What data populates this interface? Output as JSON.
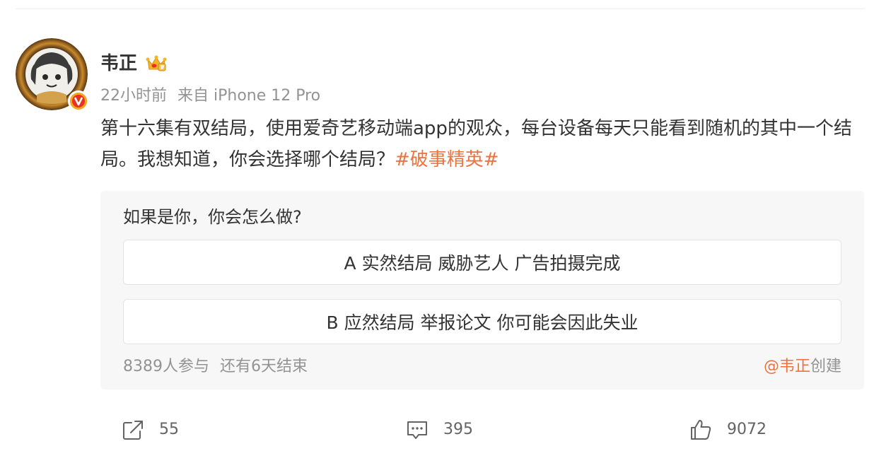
{
  "post": {
    "author": {
      "name": "韦正",
      "crown_icon": "crown-badge-icon",
      "verified_icon": "verified-v-icon"
    },
    "meta": {
      "time": "22小时前",
      "source": "来自 iPhone 12 Pro"
    },
    "text": {
      "body": "第十六集有双结局，使用爱奇艺移动端app的观众，每台设备每天只能看到随机的其中一个结局。我想知道，你会选择哪个结局？",
      "topic": "#破事精英#"
    },
    "poll": {
      "question": "如果是你，你会怎么做?",
      "options": [
        {
          "label": "A 实然结局 威胁艺人 广告拍摄完成"
        },
        {
          "label": "B 应然结局 举报论文 你可能会因此失业"
        }
      ],
      "participants": "8389人参与",
      "remaining": "还有6天结束",
      "creator": "@韦正",
      "creator_suffix": "创建"
    },
    "actions": {
      "repost": {
        "icon": "repost-icon",
        "count": "55"
      },
      "comment": {
        "icon": "comment-icon",
        "count": "395"
      },
      "like": {
        "icon": "like-icon",
        "count": "9072"
      }
    },
    "colors": {
      "accent": "#eb7340",
      "muted_text": "#939393",
      "card_bg": "#f7f7f7",
      "verified_badge": "#f5a623"
    }
  }
}
